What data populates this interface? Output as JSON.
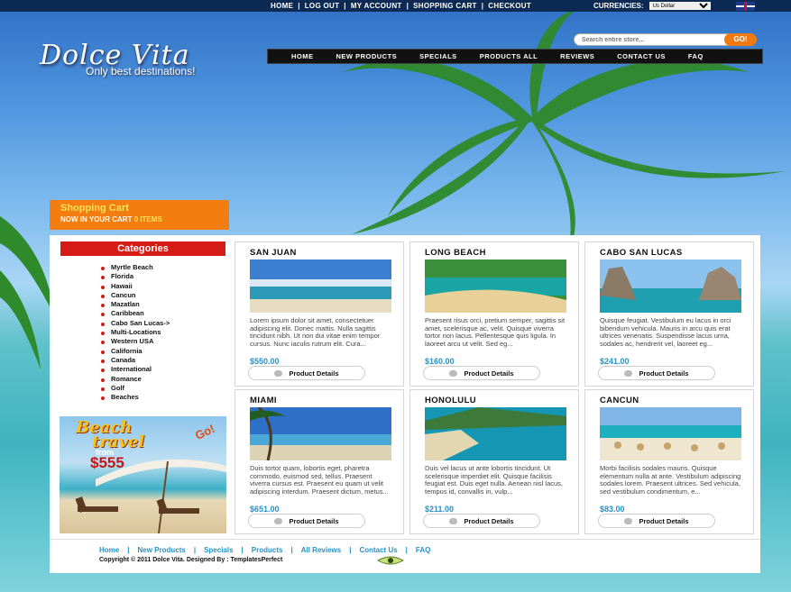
{
  "topnav": {
    "items": [
      "HOME",
      "LOG OUT",
      "MY ACCOUNT",
      "SHOPPING CART",
      "CHECKOUT"
    ],
    "separator": "|",
    "currencies_label": "CURRENCIES:",
    "currency_selected": "Us Dollar"
  },
  "logo": {
    "title": "Dolce Vita",
    "tagline": "Only best destinations!"
  },
  "search": {
    "placeholder": "Search entire store...",
    "button": "GO!"
  },
  "mainnav": [
    "HOME",
    "NEW PRODUCTS",
    "SPECIALS",
    "PRODUCTS ALL",
    "REVIEWS",
    "CONTACT US",
    "FAQ"
  ],
  "cart": {
    "title": "Shopping Cart",
    "line": "NOW IN YOUR CART",
    "count": "0 ITEMS"
  },
  "categories": {
    "title": "Categories",
    "items": [
      "Myrtle Beach",
      "Florida",
      "Hawaii",
      "Cancun",
      "Mazatlan",
      "Caribbean",
      "Cabo San Lucas->",
      "Multi-Locations",
      "Western USA",
      "California",
      "Canada",
      "International",
      "Romance",
      "Golf",
      "Beaches"
    ]
  },
  "promo": {
    "line1": "Beach",
    "line2": "travel",
    "line3": "from",
    "price": "$555",
    "badge": "Go!"
  },
  "products": [
    {
      "name": "SAN JUAN",
      "desc": "Lorem ipsum dolor sit amet, consectetuer adipiscing elit. Donec mattis. Nulla sagittis tincidunt nibh. Ut non dui vitae enim tempor cursus. Nunc iaculis rutrum elit. Cura...",
      "price": "$550.00",
      "button": "Product Details"
    },
    {
      "name": "LONG BEACH",
      "desc": "Praesent risus orci, pretium semper, sagittis sit amet, scelerisque ac, velit. Quisque viverra tortor non lacus. Pellentesque quis ligula. In laoreet arcu ut velit. Sed eg...",
      "price": "$160.00",
      "button": "Product Details"
    },
    {
      "name": "CABO SAN LUCAS",
      "desc": "Quisque feugiat. Vestibulum eu lacus in orci bibendum vehicula. Mauris in arcu quis erat ultrices venenatis. Suspendisse lacus urna, sodales ac, hendrerit vel, laoreet eg...",
      "price": "$241.00",
      "button": "Product Details"
    },
    {
      "name": "MIAMI",
      "desc": "Duis tortor quam, lobortis eget, pharetra commodo, euismod sed, tellus. Praesent viverra cursus est. Praesent eu quam ut velit adipiscing interdum. Praesent dictum, metus...",
      "price": "$651.00",
      "button": "Product Details"
    },
    {
      "name": "HONOLULU",
      "desc": "Duis vel lacus ut ante lobortis tincidunt. Ut scelerisque imperdiet elit. Quisque facilisis feugiat est. Duis eget nulla. Aenean nisl lacus, tempus id, convallis in, vulp...",
      "price": "$211.00",
      "button": "Product Details"
    },
    {
      "name": "CANCUN",
      "desc": "Morbi facilisis sodales mauris. Quisque elementum nulla at ante. Vestibulum adipiscing sodales lorem. Praesent ultrices. Sed vehicula, sed vestibulum condimentum, e...",
      "price": "$83.00",
      "button": "Product Details"
    }
  ],
  "footer": {
    "links": [
      "Home",
      "New Products",
      "Specials",
      "Products",
      "All Reviews",
      "Contact Us",
      "FAQ"
    ],
    "separator": "|",
    "copyright": "Copyright © 2011 Dolce Vita.  Designed By : TemplatesPerfect"
  },
  "colors": {
    "accent": "#f47d10",
    "category_red": "#d41b15",
    "price_blue": "#2592c8"
  }
}
